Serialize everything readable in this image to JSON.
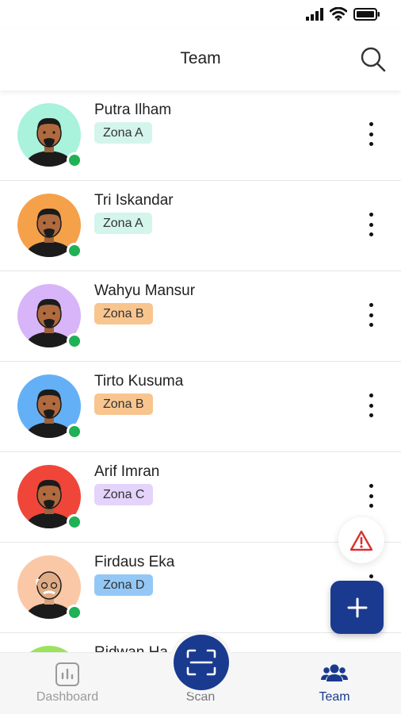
{
  "header": {
    "title": "Team"
  },
  "members": [
    {
      "name": "Putra Ilham",
      "zone": "Zona A",
      "zone_color": "#d4f5ec",
      "avatar_bg": "#a9f2dc"
    },
    {
      "name": "Tri Iskandar",
      "zone": "Zona A",
      "zone_color": "#d4f5ec",
      "avatar_bg": "#f5a14a"
    },
    {
      "name": "Wahyu Mansur",
      "zone": "Zona B",
      "zone_color": "#f8c58f",
      "avatar_bg": "#d8b4f8"
    },
    {
      "name": "Tirto Kusuma",
      "zone": "Zona B",
      "zone_color": "#f8c58f",
      "avatar_bg": "#63b0f7"
    },
    {
      "name": "Arif Imran",
      "zone": "Zona C",
      "zone_color": "#e4d3fb",
      "avatar_bg": "#f0463a"
    },
    {
      "name": "Firdaus Eka",
      "zone": "Zona D",
      "zone_color": "#93c8f6",
      "avatar_bg": "#fbc8a7"
    },
    {
      "name": "Ridwan Ha",
      "zone": "",
      "zone_color": "#d4f5ec",
      "avatar_bg": "#9be35a"
    }
  ],
  "bottom_nav": {
    "dashboard_label": "Dashboard",
    "scan_label": "Scan",
    "team_label": "Team",
    "active_color": "#1a3a8f",
    "inactive_color": "#9a9a9a"
  },
  "colors": {
    "accent": "#1a3a8f",
    "online": "#1fb155",
    "alert": "#d9312f"
  },
  "icons": {
    "search": "search-icon",
    "more": "more-vertical-icon",
    "alert": "warning-icon",
    "add": "plus-icon",
    "dashboard": "bar-chart-icon",
    "scan": "scan-icon",
    "team": "users-icon"
  }
}
